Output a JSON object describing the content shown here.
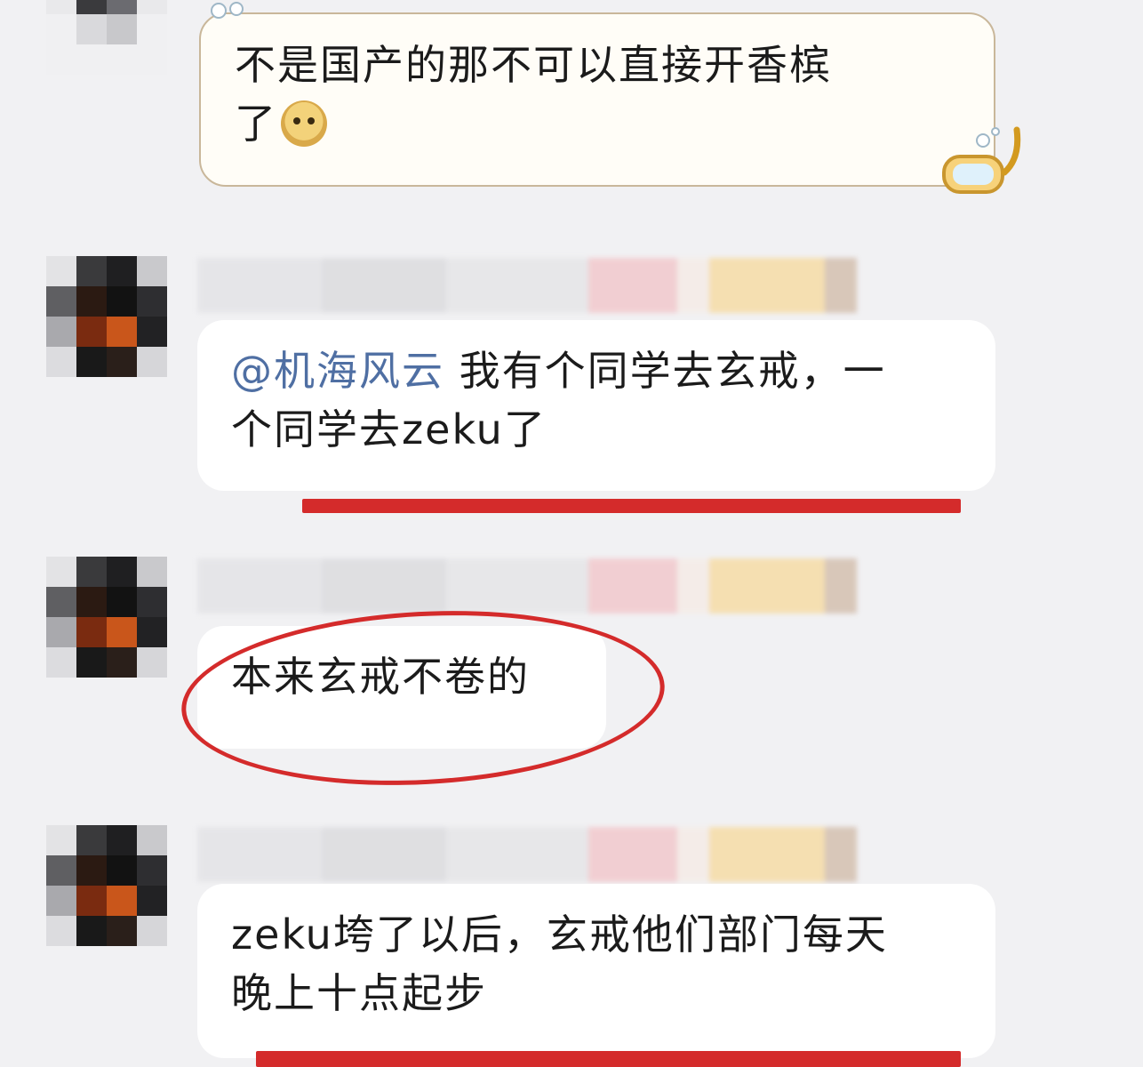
{
  "messages": [
    {
      "line1": "不是国产的那不可以直接开香槟",
      "line2": "了",
      "emoji": "doge-emoji"
    },
    {
      "mention": "@机海风云",
      "line1_rest": " 我有个同学去玄戒，一",
      "line2": "个同学去zeku了"
    },
    {
      "line1": "本来玄戒不卷的"
    },
    {
      "line1": "zeku垮了以后，玄戒他们部门每天",
      "line2": "晚上十点起步"
    }
  ],
  "colors": {
    "background": "#f1f1f3",
    "bubble": "#ffffff",
    "highlight_red": "#d42b2b",
    "mention_blue": "#4f6fa3"
  }
}
